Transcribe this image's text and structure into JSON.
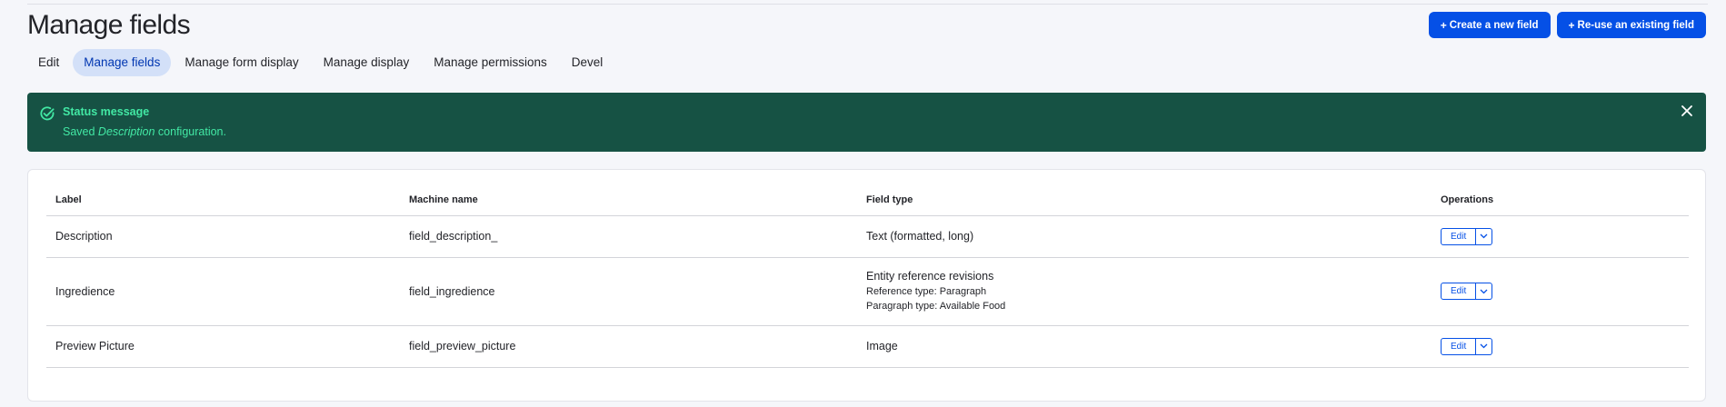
{
  "page": {
    "title": "Manage fields"
  },
  "actions": {
    "create_new": "Create a new field",
    "reuse_existing": "Re-use an existing field",
    "plus_symbol": "+"
  },
  "tabs": [
    {
      "label": "Edit",
      "active": false
    },
    {
      "label": "Manage fields",
      "active": true
    },
    {
      "label": "Manage form display",
      "active": false
    },
    {
      "label": "Manage display",
      "active": false
    },
    {
      "label": "Manage permissions",
      "active": false
    },
    {
      "label": "Devel",
      "active": false
    }
  ],
  "status": {
    "heading": "Status message",
    "prefix": "Saved ",
    "emphasis": "Description",
    "suffix": " configuration.",
    "icon": "check-circle-icon",
    "close_icon": "close-icon"
  },
  "table": {
    "headers": {
      "label": "Label",
      "machine_name": "Machine name",
      "field_type": "Field type",
      "operations": "Operations"
    },
    "rows": [
      {
        "label": "Description",
        "machine_name": "field_description_",
        "field_type": "Text (formatted, long)",
        "edit_label": "Edit"
      },
      {
        "label": "Ingredience",
        "machine_name": "field_ingredience",
        "field_type": "Entity reference revisions",
        "reference_type": "Reference type: Paragraph",
        "paragraph_type": "Paragraph type: Available Food",
        "edit_label": "Edit"
      },
      {
        "label": "Preview Picture",
        "machine_name": "field_preview_picture",
        "field_type": "Image",
        "edit_label": "Edit"
      }
    ]
  },
  "colors": {
    "primary": "#0550e6",
    "status_bg": "#165244",
    "status_text": "#42e8a4",
    "active_tab_bg": "#d3e0f8",
    "active_tab_text": "#0036b1"
  }
}
